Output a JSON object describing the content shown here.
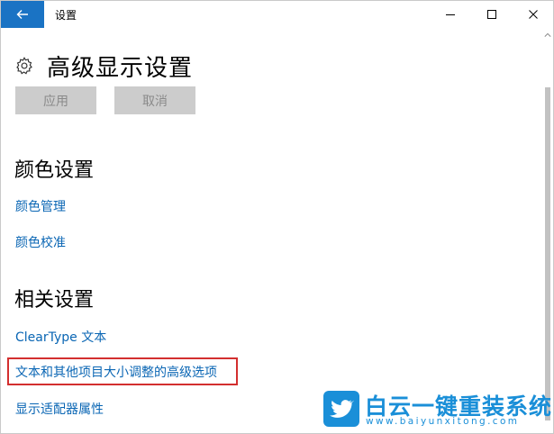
{
  "window": {
    "title": "设置"
  },
  "page": {
    "title": "高级显示设置"
  },
  "buttons": {
    "apply": "应用",
    "cancel": "取消"
  },
  "color_section": {
    "heading": "颜色设置",
    "links": [
      "颜色管理",
      "颜色校准"
    ]
  },
  "related_section": {
    "heading": "相关设置",
    "links": [
      "ClearType 文本",
      "文本和其他项目大小调整的高级选项",
      "显示适配器属性"
    ]
  },
  "highlight_color": "#d32f2f",
  "accent_color": "#1a73c4",
  "watermark": {
    "name": "白云一键重装系统",
    "url": "www.baiyunxitong.com"
  }
}
